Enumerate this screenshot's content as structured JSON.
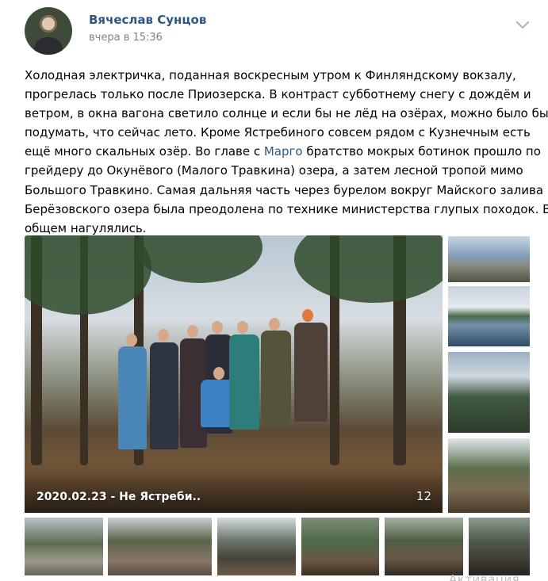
{
  "post": {
    "author": "Вячеслав Сунцов",
    "time": "вчера в 15:36",
    "text_before_mention_lines": [
      "Холодная электричка, поданная воскресным утром к Финляндскому вокзалу,",
      "прогрелась только после Приозерска. В контраст субботнему снегу с дождём и",
      "ветром, в окна вагона светило солнце и если бы не лёд на озёрах, можно было бы",
      "подумать, что сейчас лето. Кроме Ястребиного совсем рядом с Кузнечным есть"
    ],
    "line5_before": "ещё много скальных озёр. Во главе с ",
    "mention": "Марго",
    "line5_after": " братство мокрых ботинок прошло по",
    "text_after_mention_lines": [
      "грейдеру до Окунёвого (Малого Травкина) озера, а затем лесной тропой мимо",
      "Большого Травкино. Самая дальняя часть через бурелом вокруг Майского залива",
      "Берёзовского озера была преодолена по технике министерства глупых походок. В",
      "общем нагулялись."
    ]
  },
  "album": {
    "caption": "2020.02.23 - Не Ястреби..",
    "count": "12"
  },
  "icons": {
    "menu": "chevron-down-icon"
  },
  "colors": {
    "link": "#2a5885",
    "secondary_text": "#828282"
  },
  "watermark": "Активация"
}
